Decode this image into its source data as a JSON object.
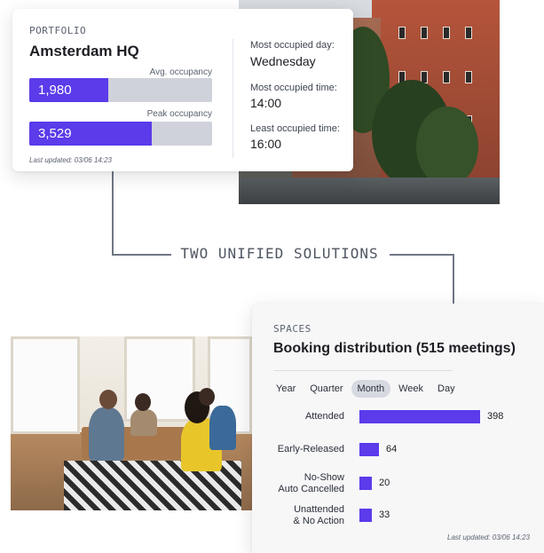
{
  "tagline": "TWO UNIFIED SOLUTIONS",
  "portfolio": {
    "eyebrow": "PORTFOLIO",
    "title": "Amsterdam HQ",
    "avg": {
      "label": "Avg. occupancy",
      "value": "1,980",
      "fraction": 0.43
    },
    "peak": {
      "label": "Peak occupancy",
      "value": "3,529",
      "fraction": 0.67
    },
    "updated": "Last updated: 03/06 14:23",
    "stats": [
      {
        "label": "Most occupied day:",
        "value": "Wednesday"
      },
      {
        "label": "Most occupied time:",
        "value": "14:00"
      },
      {
        "label": "Least occupied time:",
        "value": "16:00"
      }
    ]
  },
  "spaces": {
    "eyebrow": "SPACES",
    "title": "Booking distribution (515 meetings)",
    "tabs": [
      {
        "label": "Year",
        "active": false
      },
      {
        "label": "Quarter",
        "active": false
      },
      {
        "label": "Month",
        "active": true
      },
      {
        "label": "Week",
        "active": false
      },
      {
        "label": "Day",
        "active": false
      }
    ],
    "rows": [
      {
        "line1": "Attended",
        "line2": "",
        "value": 398
      },
      {
        "line1": "Early-Released",
        "line2": "",
        "value": 64
      },
      {
        "line1": "No-Show",
        "line2": "Auto Cancelled",
        "value": 20
      },
      {
        "line1": "Unattended",
        "line2": "& No Action",
        "value": 33
      }
    ],
    "updated": "Last updated: 03/06 14:23"
  },
  "colors": {
    "accent": "#5b3bea",
    "track": "#cfd2db",
    "connector": "#707784"
  }
}
